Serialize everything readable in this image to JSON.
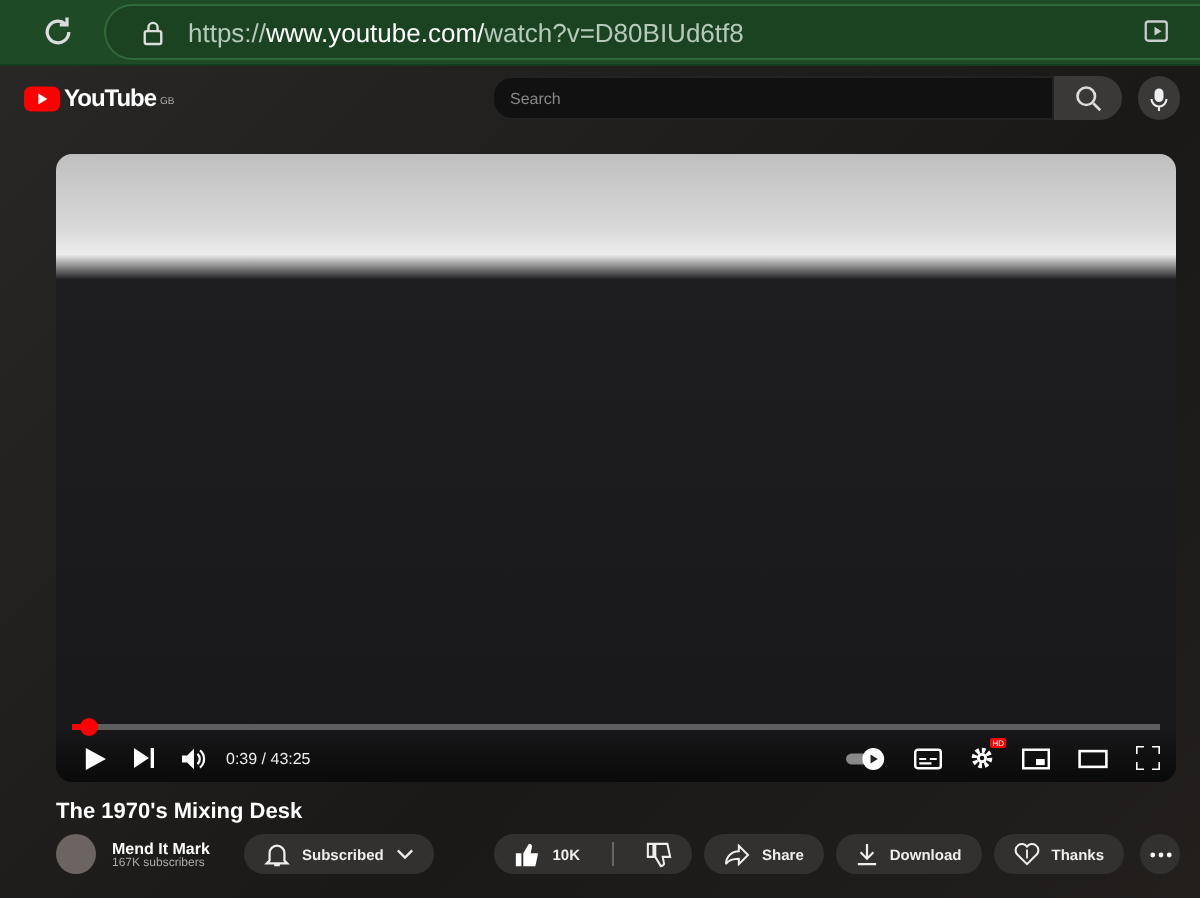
{
  "browser": {
    "url_host": "https://www.youtube.com/",
    "url_path": "watch?v=D80BIUd6tf8"
  },
  "header": {
    "logo": "YouTube",
    "region": "GB",
    "search": {
      "placeholder": "Search"
    }
  },
  "player": {
    "progress": {
      "level": 0.015
    },
    "time": "0:39 / 43:25",
    "hd_badge": "HD"
  },
  "video": {
    "title": "The 1970's Mixing Desk",
    "channel": "Mend It Mark",
    "subscribers": "167K subscribers",
    "subscribe_button": "Subscribed",
    "likes": "10K",
    "actions": [
      "Share",
      "Download",
      "Thanks"
    ]
  }
}
